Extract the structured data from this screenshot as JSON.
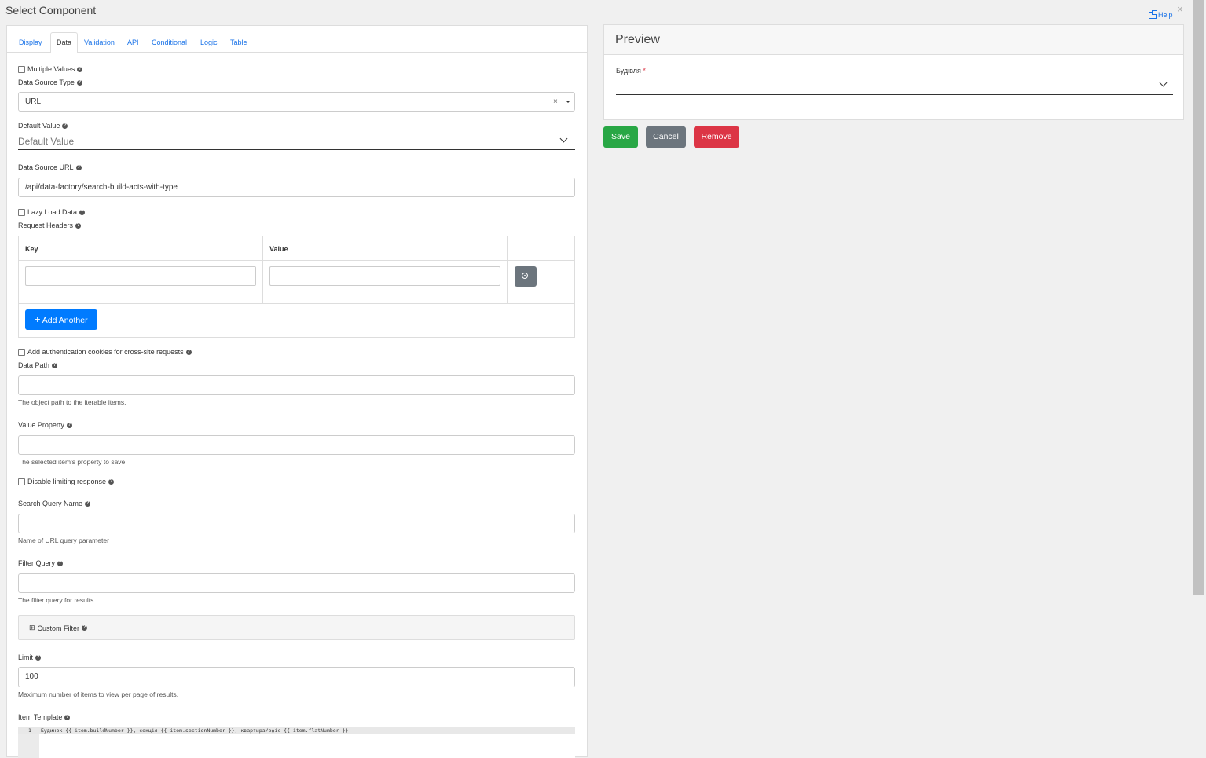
{
  "window": {
    "title": "Select Component",
    "help_label": "Help",
    "close_symbol": "×"
  },
  "tabs": [
    {
      "label": "Display",
      "active": false
    },
    {
      "label": "Data",
      "active": true
    },
    {
      "label": "Validation",
      "active": false
    },
    {
      "label": "API",
      "active": false
    },
    {
      "label": "Conditional",
      "active": false
    },
    {
      "label": "Logic",
      "active": false
    },
    {
      "label": "Table",
      "active": false
    }
  ],
  "form": {
    "multiple_values": {
      "label": "Multiple Values",
      "checked": false
    },
    "data_source_type": {
      "label": "Data Source Type",
      "value": "URL",
      "clear_symbol": "×"
    },
    "default_value": {
      "label": "Default Value",
      "placeholder": "Default Value"
    },
    "data_source_url": {
      "label": "Data Source URL",
      "value": "/api/data-factory/search-build-acts-with-type"
    },
    "lazy_load": {
      "label": "Lazy Load Data",
      "checked": false
    },
    "request_headers": {
      "label": "Request Headers",
      "columns": [
        "Key",
        "Value"
      ],
      "rows": [
        {
          "key": "",
          "value": ""
        }
      ],
      "add_label": "Add Another",
      "add_symbol": "+"
    },
    "auth_cookies": {
      "label": "Add authentication cookies for cross-site requests",
      "checked": false
    },
    "data_path": {
      "label": "Data Path",
      "value": "",
      "hint": "The object path to the iterable items."
    },
    "value_property": {
      "label": "Value Property",
      "value": "",
      "hint": "The selected item's property to save."
    },
    "disable_limiting": {
      "label": "Disable limiting response",
      "checked": false
    },
    "search_query_name": {
      "label": "Search Query Name",
      "value": "",
      "hint": "Name of URL query parameter"
    },
    "filter_query": {
      "label": "Filter Query",
      "value": "",
      "hint": "The filter query for results."
    },
    "custom_filter": {
      "label": "Custom Filter",
      "symbol": "⊞"
    },
    "limit": {
      "label": "Limit",
      "value": "100",
      "hint": "Maximum number of items to view per page of results."
    },
    "item_template": {
      "label": "Item Template",
      "line_number": "1",
      "code": "Будинок {{ item.buildNumber }}, секція {{ item.sectionNumber }}, квартира/офіс {{ item.flatNumber }}"
    }
  },
  "preview": {
    "title": "Preview",
    "field_label": "Будівля",
    "required_mark": "*"
  },
  "actions": {
    "save": "Save",
    "cancel": "Cancel",
    "remove": "Remove"
  },
  "colors": {
    "save": "#28a745",
    "cancel": "#6c757d",
    "remove": "#dc3545",
    "accent": "#007bff"
  }
}
